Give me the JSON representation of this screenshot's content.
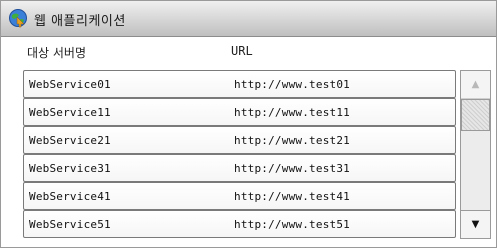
{
  "window": {
    "title": "웹 애플리케이션",
    "icon": "web-app-globe-icon"
  },
  "table": {
    "columns": [
      "대상 서버명",
      "URL"
    ],
    "rows": [
      {
        "name": "WebService01",
        "url": "http://www.test01"
      },
      {
        "name": "WebService11",
        "url": "http://www.test11"
      },
      {
        "name": "WebService21",
        "url": "http://www.test21"
      },
      {
        "name": "WebService31",
        "url": "http://www.test31"
      },
      {
        "name": "WebService41",
        "url": "http://www.test41"
      },
      {
        "name": "WebService51",
        "url": "http://www.test51"
      }
    ]
  },
  "scrollbar": {
    "up_glyph": "▲",
    "down_glyph": "▼",
    "up_enabled": false,
    "down_enabled": true
  }
}
